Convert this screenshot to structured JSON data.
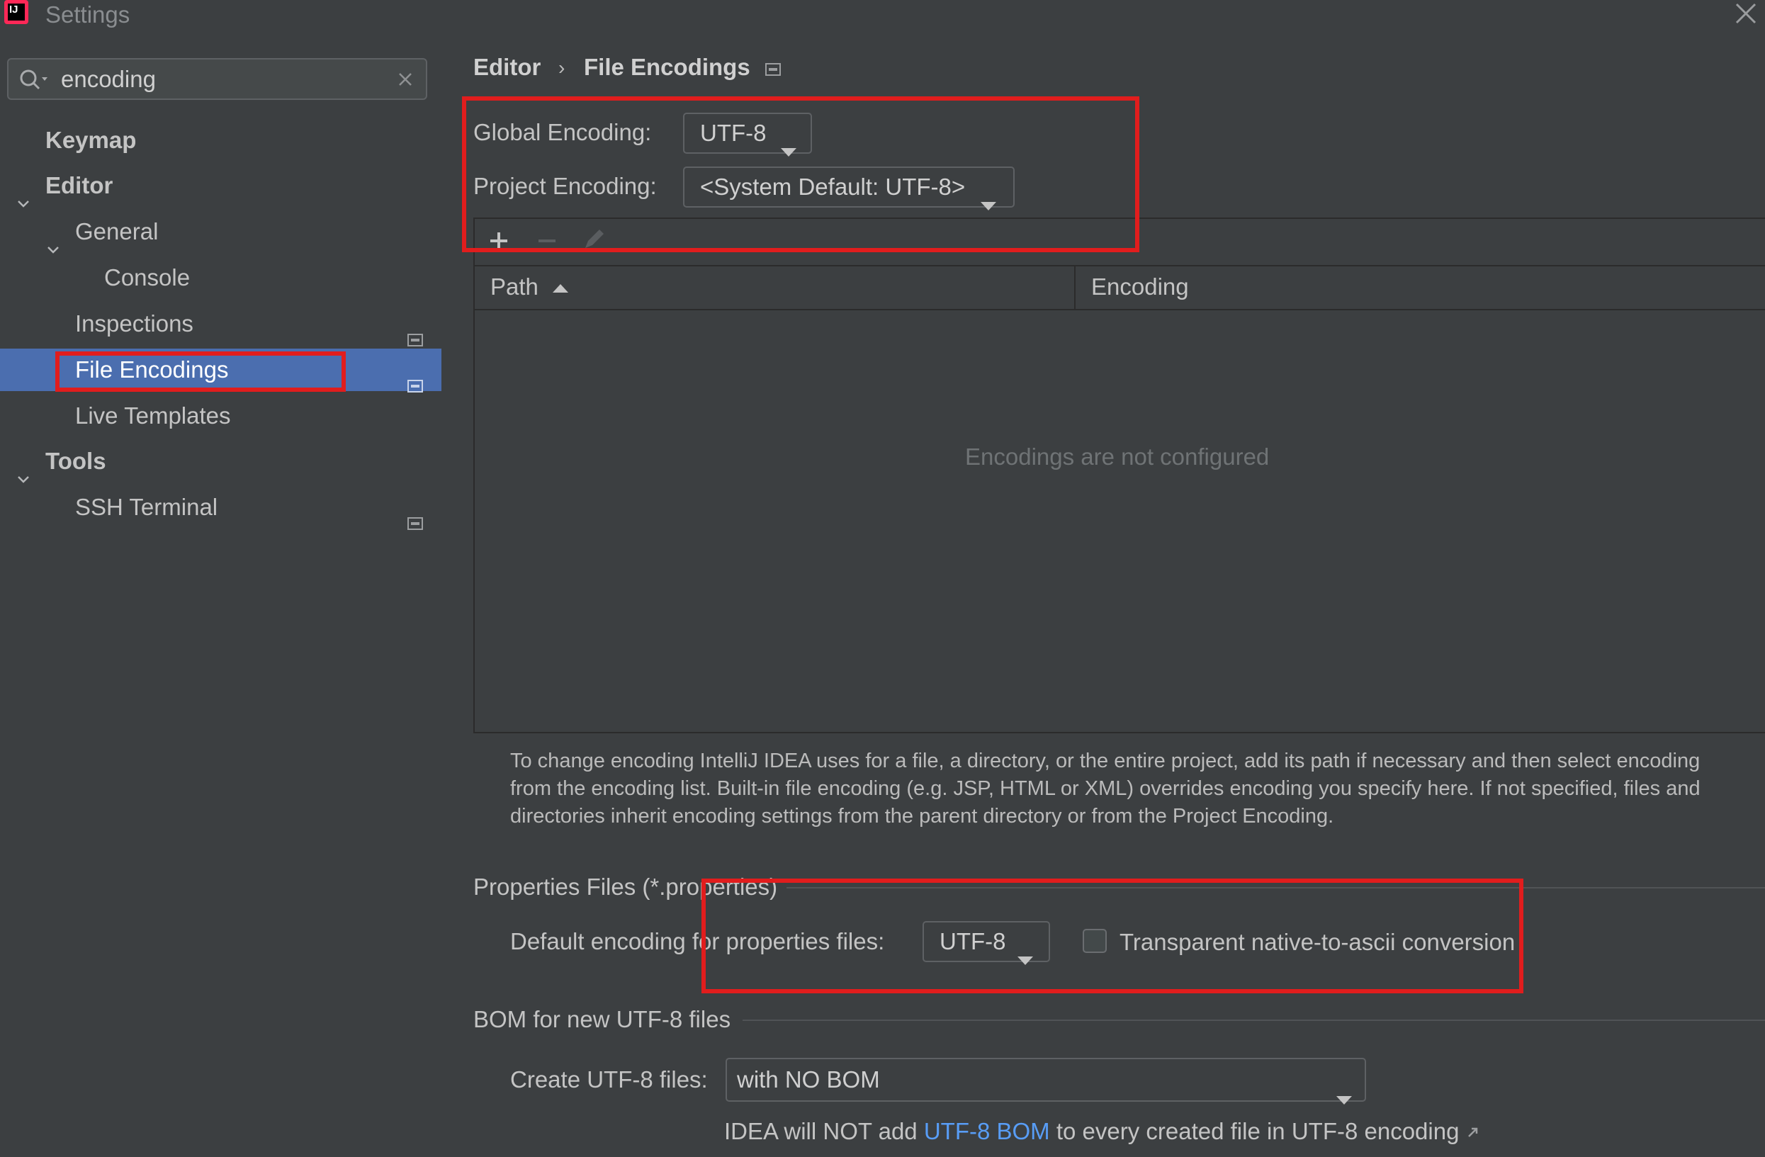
{
  "window": {
    "title": "Settings",
    "logo_text": "IJ"
  },
  "search": {
    "value": "encoding"
  },
  "sidebar": {
    "items": [
      {
        "label": "Keymap"
      },
      {
        "label": "Editor"
      },
      {
        "label": "General"
      },
      {
        "label": "Console"
      },
      {
        "label": "Inspections"
      },
      {
        "label": "File Encodings"
      },
      {
        "label": "Live Templates"
      },
      {
        "label": "Tools"
      },
      {
        "label": "SSH Terminal"
      }
    ]
  },
  "breadcrumb": {
    "parent": "Editor",
    "separator": "›",
    "current": "File Encodings"
  },
  "global_encoding": {
    "label": "Global Encoding:",
    "value": "UTF-8"
  },
  "project_encoding": {
    "label": "Project Encoding:",
    "value": "<System Default: UTF-8>"
  },
  "table": {
    "columns": [
      "Path",
      "Encoding"
    ],
    "empty_text": "Encodings are not configured"
  },
  "help_text": "To change encoding IntelliJ IDEA uses for a file, a directory, or the entire project, add its path if necessary and then select encoding from the encoding list. Built-in file encoding (e.g. JSP, HTML or XML) overrides encoding you specify here. If not specified, files and directories inherit encoding settings from the parent directory or from the Project Encoding.",
  "properties_files": {
    "section_title": "Properties Files (*.properties)",
    "default_label": "Default encoding for properties files:",
    "default_value": "UTF-8",
    "transparent_label": "Transparent native-to-ascii conversion",
    "transparent_checked": false
  },
  "bom": {
    "section_title": "BOM for new UTF-8 files",
    "create_label": "Create UTF-8 files:",
    "create_value": "with NO BOM",
    "note_before": "IDEA will NOT add",
    "note_link": "UTF-8 BOM",
    "note_after": "to every created file in UTF-8 encoding"
  },
  "colors": {
    "background": "#3c3f41",
    "selection": "#4b6eaf",
    "link": "#589df6",
    "highlight_box": "#e11d1d"
  }
}
